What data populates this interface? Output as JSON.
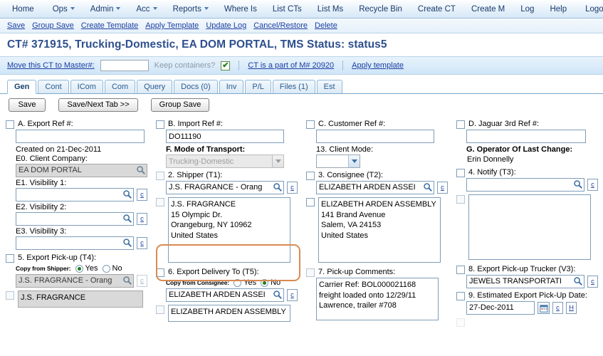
{
  "topnav": {
    "items": [
      {
        "label": "Home",
        "dropdown": false,
        "sep_after": true
      },
      {
        "label": "Ops",
        "dropdown": true,
        "sep_after": false
      },
      {
        "label": "Admin",
        "dropdown": true,
        "sep_after": false
      },
      {
        "label": "Acc",
        "dropdown": true,
        "sep_after": false
      },
      {
        "label": "Reports",
        "dropdown": true,
        "sep_after": false
      },
      {
        "label": "Where Is",
        "dropdown": false,
        "sep_after": false
      },
      {
        "label": "List CTs",
        "dropdown": false,
        "sep_after": false
      },
      {
        "label": "List Ms",
        "dropdown": false,
        "sep_after": false
      },
      {
        "label": "Recycle Bin",
        "dropdown": false,
        "sep_after": false
      },
      {
        "label": "Create CT",
        "dropdown": false,
        "sep_after": false
      },
      {
        "label": "Create M",
        "dropdown": false,
        "sep_after": false
      },
      {
        "label": "Log",
        "dropdown": false,
        "sep_after": false
      },
      {
        "label": "Help",
        "dropdown": false,
        "sep_after": true
      },
      {
        "label": "Logout",
        "dropdown": false,
        "sep_after": false
      }
    ]
  },
  "actionbar": {
    "links": [
      "Save",
      "Group Save",
      "Create Template",
      "Apply Template",
      "Update Log",
      "Cancel/Restore",
      "Delete"
    ]
  },
  "title": "CT# 371915, Trucking-Domestic, EA DOM PORTAL, TMS Status: status5",
  "masterbar": {
    "move_link": "Move this CT to Master#:",
    "master_input_value": "",
    "keep_containers_label": "Keep containers?",
    "keep_containers_checked": true,
    "part_of_link": "CT is a part of M# 20920",
    "apply_template_link": "Apply template"
  },
  "tabs": [
    {
      "label": "Gen",
      "active": true
    },
    {
      "label": "Cont",
      "active": false
    },
    {
      "label": "ICom",
      "active": false
    },
    {
      "label": "Com",
      "active": false
    },
    {
      "label": "Query",
      "active": false
    },
    {
      "label": "Docs (0)",
      "active": false
    },
    {
      "label": "Inv",
      "active": false
    },
    {
      "label": "P/L",
      "active": false
    },
    {
      "label": "Files (1)",
      "active": false
    },
    {
      "label": "Est",
      "active": false
    }
  ],
  "buttons": {
    "save": "Save",
    "save_next_tab": "Save/Next Tab >>",
    "group_save": "Group Save"
  },
  "form": {
    "export_ref": {
      "label": "A. Export Ref #:",
      "value": ""
    },
    "created_on": "Created on 21-Dec-2011",
    "client_company": {
      "label": "E0. Client Company:",
      "value": "EA DOM PORTAL"
    },
    "visibility1": {
      "label": "E1. Visibility 1:",
      "value": ""
    },
    "visibility2": {
      "label": "E2. Visibility 2:",
      "value": ""
    },
    "visibility3": {
      "label": "E3. Visibility 3:",
      "value": ""
    },
    "import_ref": {
      "label": "B. Import Ref #:",
      "value": "DO11190"
    },
    "mode_of_transport": {
      "label": "F. Mode of Transport:",
      "value": "Trucking-Domestic"
    },
    "shipper": {
      "label": "2. Shipper (T1):",
      "value": "J.S. FRAGRANCE - Orang",
      "address": "J.S. FRAGRANCE\n15 Olympic Dr.\nOrangeburg, NY 10962\nUnited States"
    },
    "customer_ref": {
      "label": "C. Customer Ref #:",
      "value": ""
    },
    "client_mode": {
      "label": "13. Client Mode:",
      "value": ""
    },
    "consignee": {
      "label": "3. Consignee (T2):",
      "value": "ELIZABETH ARDEN ASSEI",
      "address": "ELIZABETH ARDEN ASSEMBLY\n141 Brand Avenue\nSalem, VA 24153\nUnited States"
    },
    "jaguar_ref": {
      "label": "D. Jaguar 3rd Ref #:",
      "value": ""
    },
    "operator_last_change": {
      "label": "G. Operator Of Last Change:",
      "value": "Erin Donnelly"
    },
    "notify": {
      "label": "4. Notify (T3):",
      "value": "",
      "address": ""
    },
    "export_pickup": {
      "label": "5. Export Pick-up (T4):",
      "copy_label": "Copy from Shipper:",
      "copy_yes": "Yes",
      "copy_no": "No",
      "copy_selected": "Yes",
      "value": "J.S. FRAGRANCE - Orang",
      "address": "J.S. FRAGRANCE"
    },
    "export_delivery": {
      "label": "6. Export Delivery To (T5):",
      "copy_label": "Copy from Consignee:",
      "copy_yes": "Yes",
      "copy_no": "No",
      "copy_selected": "No",
      "value": "ELIZABETH ARDEN ASSEI",
      "address": "ELIZABETH ARDEN ASSEMBLY"
    },
    "pickup_comments": {
      "label": "7. Pick-up Comments:",
      "value": " Carrier Ref: BOL000021168\nfreight loaded onto 12/29/11\nLawrence, trailer #708"
    },
    "pickup_trucker": {
      "label": "8. Export Pick-up Trucker (V3):",
      "value": "JEWELS TRANSPORTATI"
    },
    "pickup_date": {
      "label": "9. Estimated Export Pick-Up Date:",
      "value": "27-Dec-2011"
    },
    "c_button": "c",
    "h_button": "H"
  }
}
